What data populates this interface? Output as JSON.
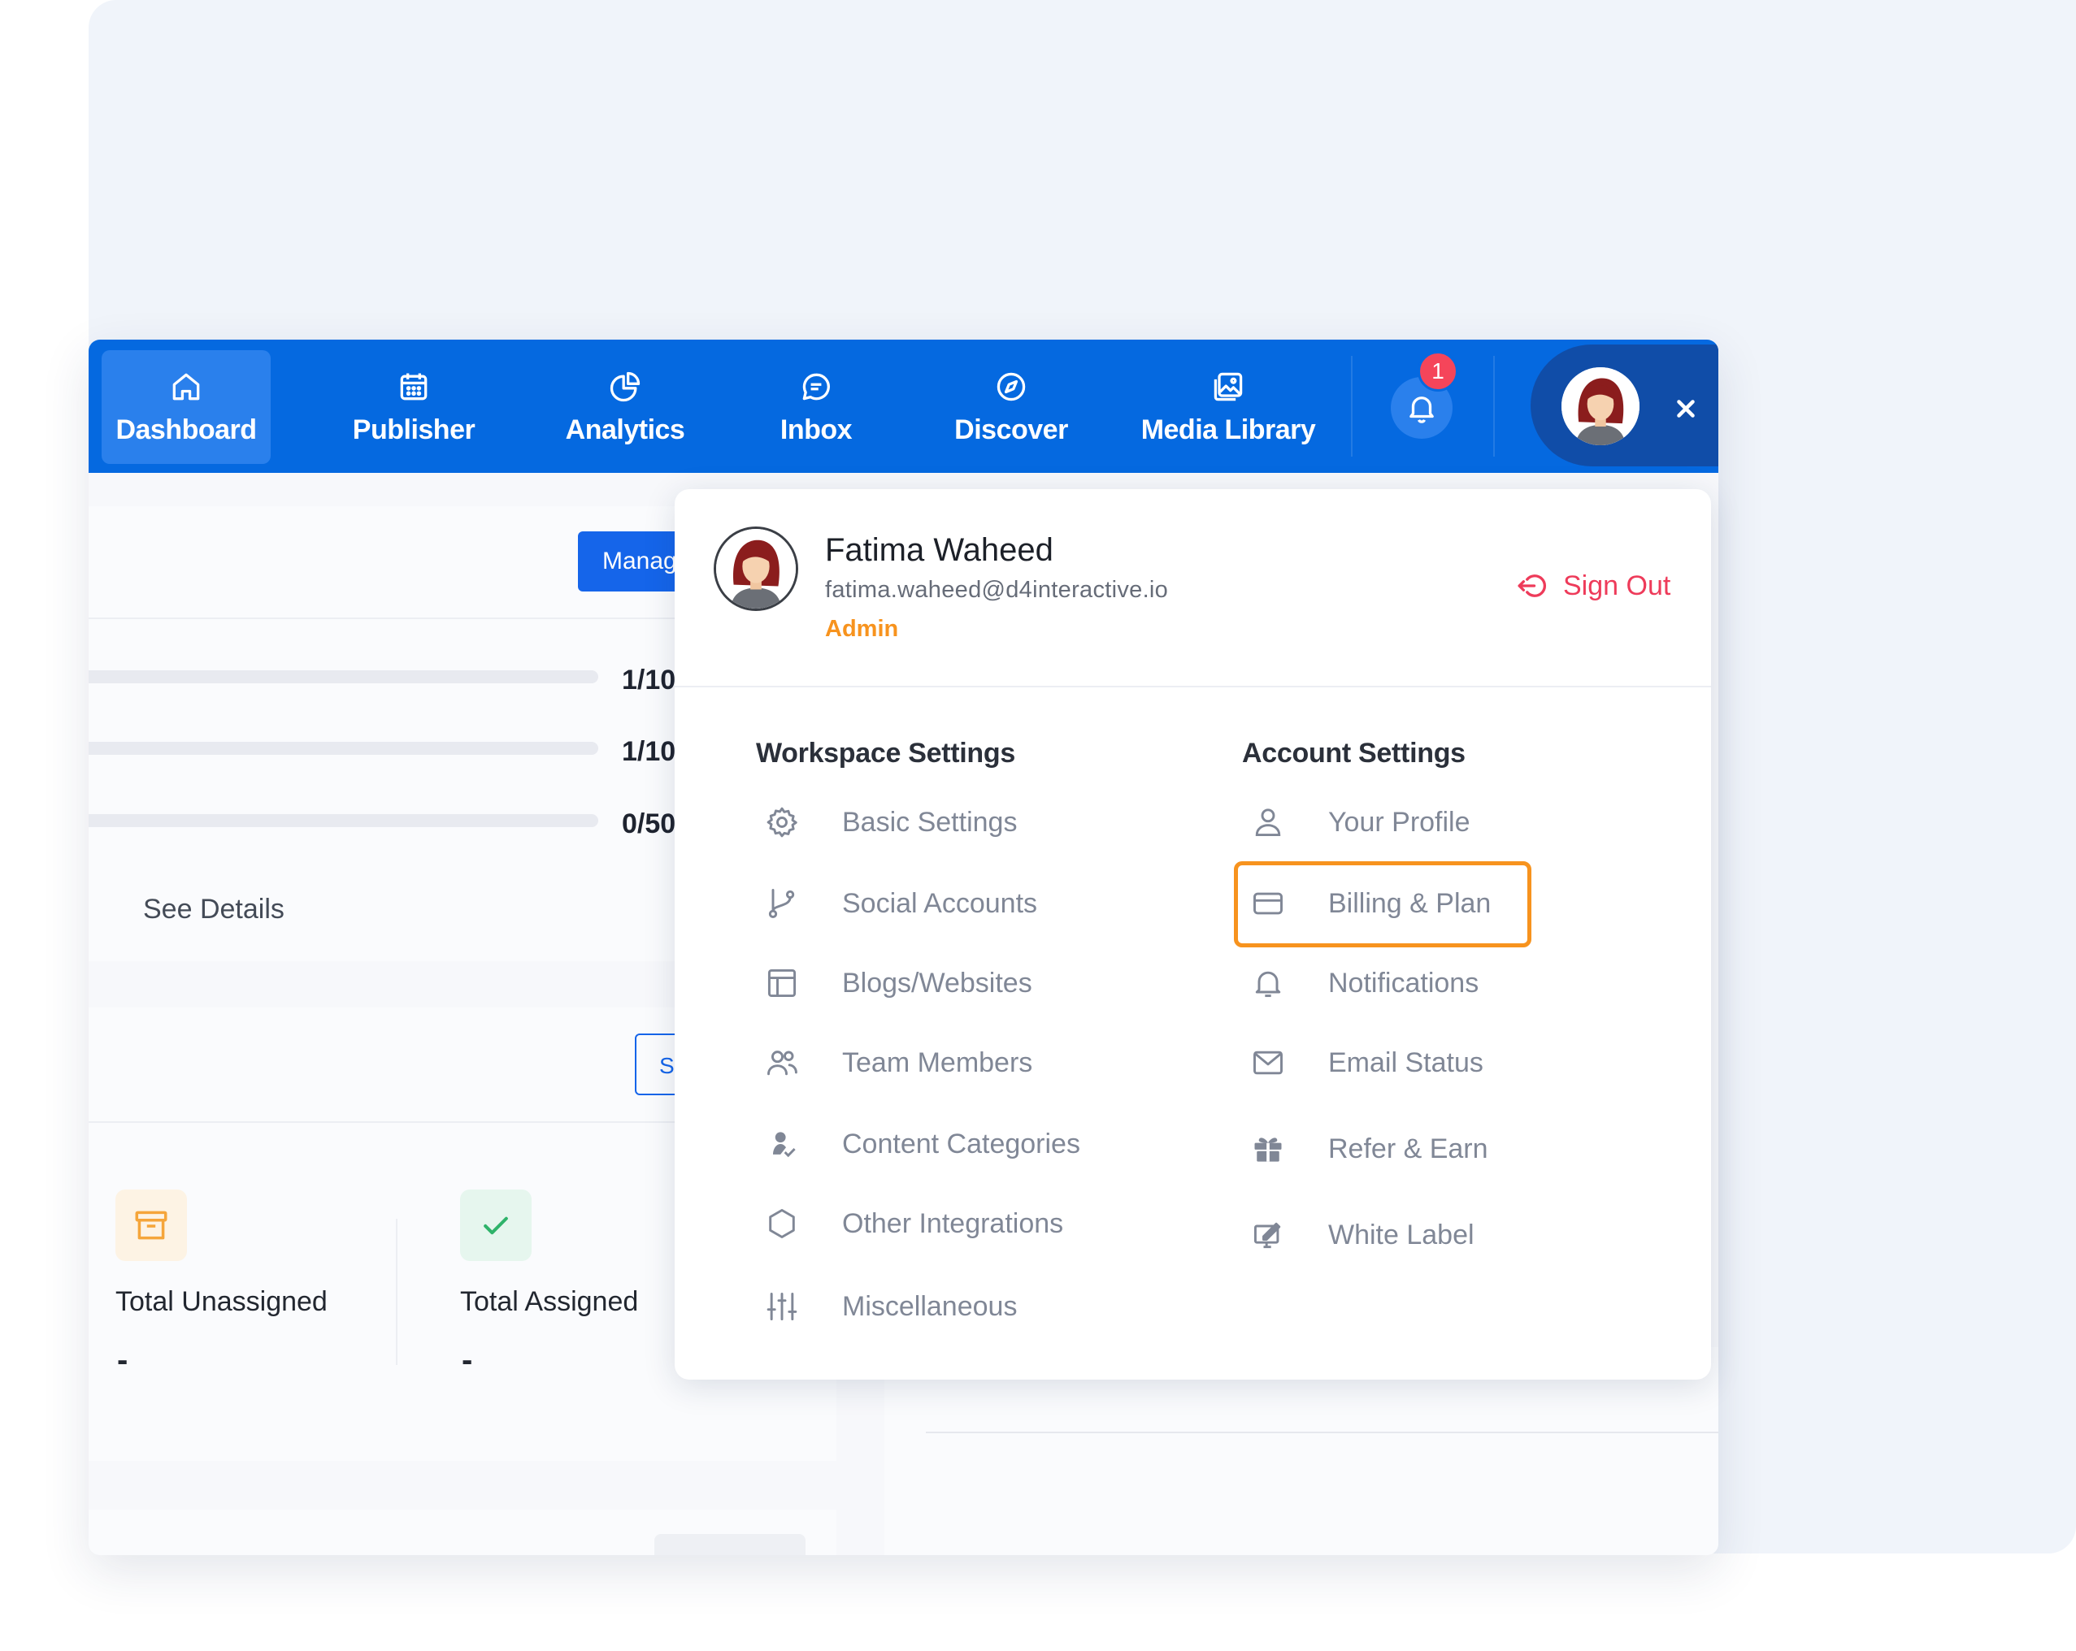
{
  "nav": {
    "items": [
      {
        "label": "Dashboard",
        "icon": "home-icon"
      },
      {
        "label": "Publisher",
        "icon": "calendar-icon"
      },
      {
        "label": "Analytics",
        "icon": "pie-chart-icon"
      },
      {
        "label": "Inbox",
        "icon": "chat-icon"
      },
      {
        "label": "Discover",
        "icon": "compass-icon"
      },
      {
        "label": "Media Library",
        "icon": "image-icon"
      }
    ],
    "notification_count": "1",
    "close_label": "×"
  },
  "background": {
    "manage_button": "Manage",
    "usage": [
      "1/10",
      "1/10",
      "0/50"
    ],
    "see_details": "See Details",
    "secondary_button": "S",
    "stats": [
      {
        "label": "Total Unassigned",
        "value": "-"
      },
      {
        "label": "Total Assigned",
        "value": "-"
      }
    ]
  },
  "dropdown": {
    "name": "Fatima Waheed",
    "email": "fatima.waheed@d4interactive.io",
    "role": "Admin",
    "sign_out": "Sign Out",
    "workspace": {
      "title": "Workspace Settings",
      "items": [
        {
          "label": "Basic Settings",
          "icon": "gear-icon"
        },
        {
          "label": "Social Accounts",
          "icon": "branch-icon"
        },
        {
          "label": "Blogs/Websites",
          "icon": "layout-icon"
        },
        {
          "label": "Team Members",
          "icon": "users-icon"
        },
        {
          "label": "Content Categories",
          "icon": "category-icon"
        },
        {
          "label": "Other Integrations",
          "icon": "hexagon-icon"
        },
        {
          "label": "Miscellaneous",
          "icon": "sliders-icon"
        }
      ]
    },
    "account": {
      "title": "Account Settings",
      "items": [
        {
          "label": "Your Profile",
          "icon": "user-icon"
        },
        {
          "label": "Billing & Plan",
          "icon": "credit-card-icon"
        },
        {
          "label": "Notifications",
          "icon": "bell-icon"
        },
        {
          "label": "Email Status",
          "icon": "mail-icon"
        },
        {
          "label": "Refer & Earn",
          "icon": "gift-icon"
        },
        {
          "label": "White Label",
          "icon": "white-label-icon"
        }
      ]
    }
  },
  "colors": {
    "nav_bg": "#0569e0",
    "accent_orange": "#f7931e",
    "sign_out_red": "#ee3b5a",
    "badge_red": "#f5455a"
  }
}
